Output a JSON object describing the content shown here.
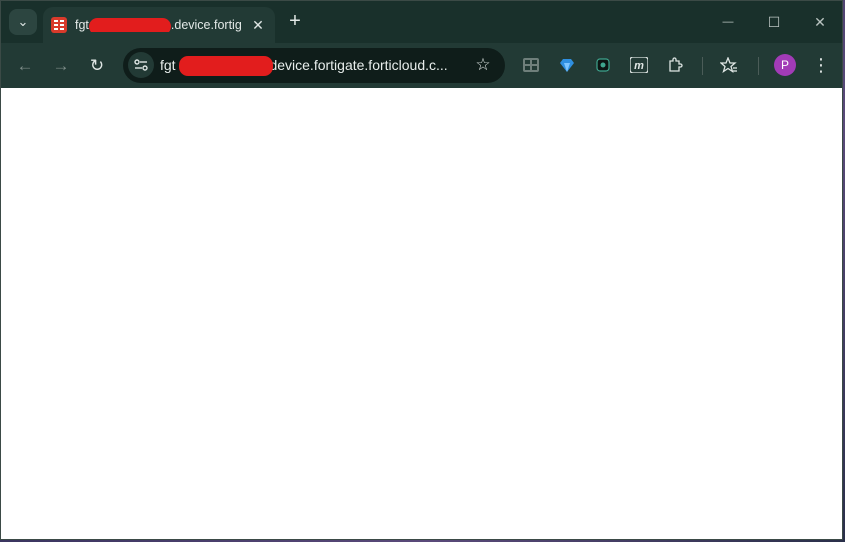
{
  "tab": {
    "title_prefix": "fgt",
    "title_suffix": ".device.fortig",
    "close_glyph": "✕"
  },
  "tabstrip": {
    "new_tab_glyph": "+",
    "search_glyph": "⌄"
  },
  "window_controls": {
    "minimize": "—",
    "maximize": "☐",
    "close": "✕"
  },
  "toolbar": {
    "back_glyph": "←",
    "forward_glyph": "→",
    "reload_glyph": "↻",
    "url_prefix": "fgt",
    "url_suffix": ".device.fortigate.forticloud.c...",
    "bookmark_glyph": "☆",
    "profile_initial": "P",
    "menu_glyph": "⋮"
  },
  "icons": [
    "tab-search-icon",
    "fortinet-favicon",
    "back-arrow-icon",
    "forward-arrow-icon",
    "reload-icon",
    "site-settings-icon",
    "bookmark-star-icon",
    "extension-grid-icon",
    "extension-gem-icon",
    "extension-chip-icon",
    "extension-m-icon",
    "extensions-puzzle-icon",
    "reading-list-icon",
    "profile-avatar",
    "more-menu-icon"
  ],
  "colors": {
    "frame": "#19302b",
    "toolbar": "#223a35",
    "omnibox": "#0f1d1a",
    "redaction": "#e21d1d",
    "favicon": "#d93a2b",
    "avatar": "#a23bb7"
  }
}
